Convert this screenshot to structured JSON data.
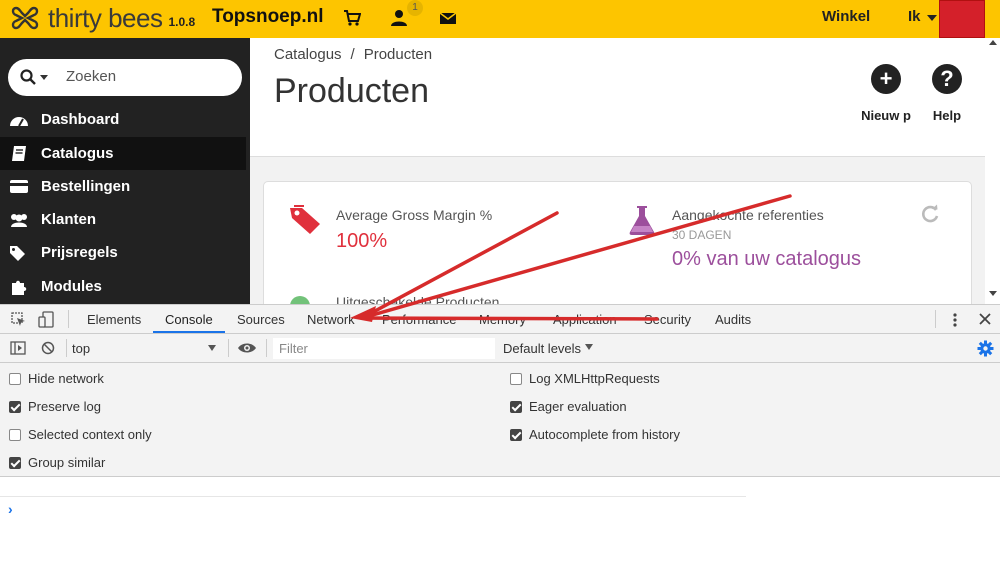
{
  "topbar": {
    "brand": "thirty bees",
    "version": "1.0.8",
    "shop_name": "Topsnoep.nl",
    "notification_count": "1",
    "shop_link": "Winkel",
    "me_link": "Ik",
    "bg_color": "#fdc500"
  },
  "sidebar": {
    "search_placeholder": "Zoeken",
    "items": [
      {
        "label": "Dashboard",
        "icon": "dashboard-icon"
      },
      {
        "label": "Catalogus",
        "icon": "book-icon",
        "active": true
      },
      {
        "label": "Bestellingen",
        "icon": "credit-card-icon"
      },
      {
        "label": "Klanten",
        "icon": "users-icon"
      },
      {
        "label": "Prijsregels",
        "icon": "tags-icon"
      },
      {
        "label": "Modules",
        "icon": "puzzle-icon"
      }
    ]
  },
  "header": {
    "breadcrumb": [
      "Catalogus",
      "/",
      "Producten"
    ],
    "title": "Producten",
    "new_label": "Nieuw p",
    "help_label": "Help"
  },
  "kpis": {
    "margin": {
      "title": "Average Gross Margin %",
      "value": "100%"
    },
    "purchased": {
      "title": "Aangekochte referenties",
      "subtitle": "30 DAGEN",
      "value": "0% van uw catalogus"
    },
    "partial": {
      "title": "Uitgeschakelde Producten"
    }
  },
  "devtools": {
    "tabs": [
      "Elements",
      "Console",
      "Sources",
      "Network",
      "Performance",
      "Memory",
      "Application",
      "Security",
      "Audits"
    ],
    "active_tab": "Console",
    "context": "top",
    "filter_placeholder": "Filter",
    "levels": "Default levels",
    "options_left": [
      {
        "label": "Hide network",
        "checked": false
      },
      {
        "label": "Preserve log",
        "checked": true
      },
      {
        "label": "Selected context only",
        "checked": false
      },
      {
        "label": "Group similar",
        "checked": true
      }
    ],
    "options_right": [
      {
        "label": "Log XMLHttpRequests",
        "checked": false
      },
      {
        "label": "Eager evaluation",
        "checked": true
      },
      {
        "label": "Autocomplete from history",
        "checked": true
      }
    ],
    "prompt": "›"
  }
}
